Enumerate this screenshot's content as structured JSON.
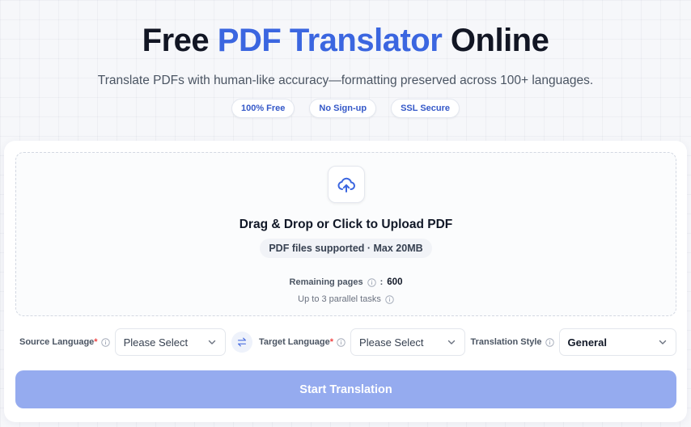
{
  "hero": {
    "title_part1": "Free",
    "title_accent": "PDF Translator",
    "title_part2": "Online",
    "subtitle": "Translate PDFs with human-like accuracy—formatting preserved across 100+ languages."
  },
  "badges": [
    "100% Free",
    "No Sign-up",
    "SSL Secure"
  ],
  "upload": {
    "icon": "cloud-upload-icon",
    "title": "Drag & Drop or Click to Upload PDF",
    "file_hint": "PDF files supported · Max 20MB",
    "remaining_label": "Remaining pages",
    "remaining_separator": ":",
    "remaining_count": "600",
    "parallel_note": "Up to 3 parallel tasks"
  },
  "languages": {
    "source_label": "Source Language",
    "source_value": "Please Select",
    "target_label": "Target Language",
    "target_value": "Please Select",
    "style_label": "Translation Style",
    "style_value": "General",
    "required_mark": "*"
  },
  "actions": {
    "start_label": "Start Translation"
  },
  "colors": {
    "accent": "#3b66e0",
    "badge_text": "#3458c8",
    "button_bg": "#95abef",
    "required": "#ef4444"
  }
}
